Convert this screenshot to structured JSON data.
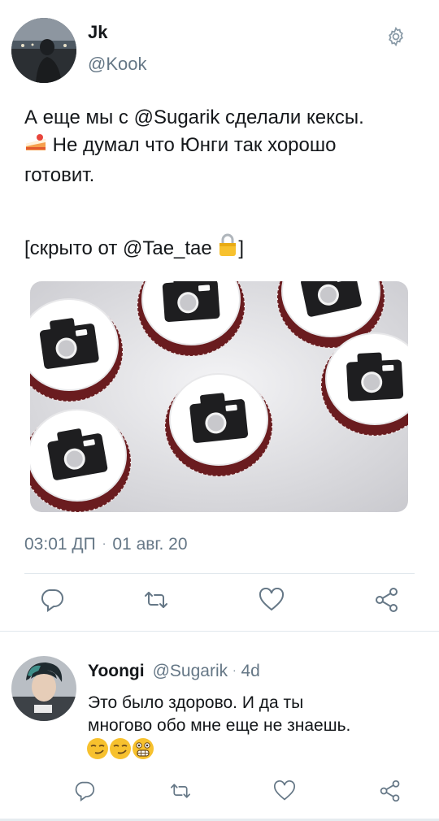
{
  "tweet": {
    "author_name": "Jk",
    "author_handle": "@Kook",
    "text_line1": "А еще мы с @Sugarik сделали кексы.",
    "text_line2": "Не думал что Юнги так хорошо",
    "text_line3": "готовит.",
    "hidden_open": "[скрыто от @Tae_tae ",
    "hidden_close": "]",
    "time": "03:01 ДП",
    "date": "01 авг. 20",
    "dot": "·"
  },
  "reply": {
    "author_name": "Yoongi",
    "author_handle": "@Sugarik",
    "dot": "·",
    "age": "4d",
    "text_line1": "Это было здорово. И да ты",
    "text_line2": "многово обо мне еще не знаешь."
  },
  "icons": {
    "gear": "gear-icon",
    "reply": "reply-icon",
    "retweet": "retweet-icon",
    "like": "heart-icon",
    "share": "share-icon",
    "emoji_cake": "cake-emoji",
    "emoji_lock": "lock-emoji",
    "emoji_smirk": "smirk-emoji",
    "emoji_grimace": "grimace-emoji"
  },
  "colors": {
    "text": "#14171a",
    "secondary": "#657786",
    "icon": "#657786",
    "divider": "#e1e8ed"
  }
}
